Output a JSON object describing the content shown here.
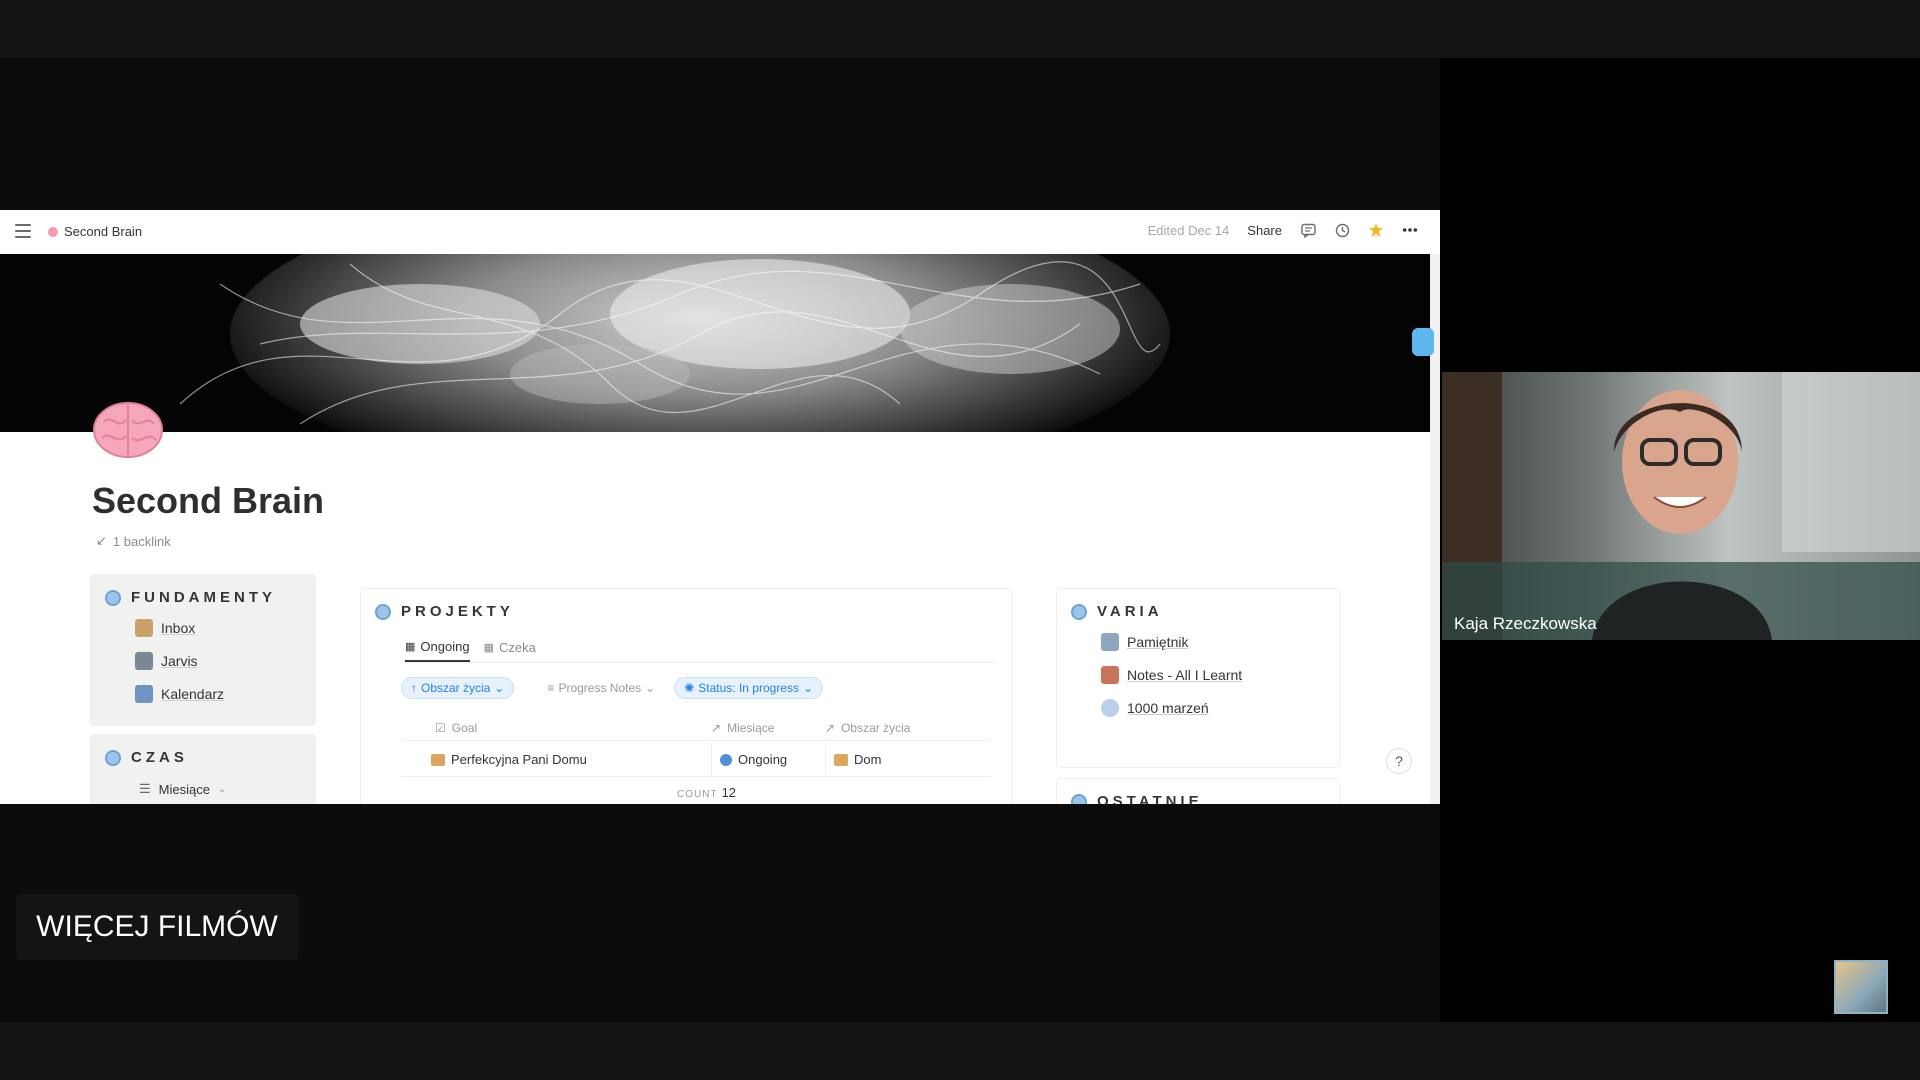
{
  "app": {
    "breadcrumb": "Second Brain",
    "edited": "Edited Dec 14",
    "share_label": "Share",
    "accent_color": "#2383e2"
  },
  "page": {
    "title": "Second Brain",
    "backlink": "1 backlink"
  },
  "fundamenty": {
    "title": "FUNDAMENTY",
    "items": [
      "Inbox",
      "Jarvis",
      "Kalendarz"
    ]
  },
  "czas": {
    "title": "CZAS",
    "view_label": "Miesiące"
  },
  "projekty": {
    "title": "PROJEKTY",
    "tabs": [
      "Ongoing",
      "Czeka"
    ],
    "filters": [
      "Obszar życia",
      "Progress Notes",
      "Status: In progress"
    ],
    "columns": [
      "Goal",
      "Miesiące",
      "Obszar życia"
    ],
    "rows": [
      {
        "goal": "Perfekcyjna Pani Domu",
        "status": "Ongoing",
        "area": "Dom"
      }
    ],
    "count_label": "COUNT",
    "count_value": "12"
  },
  "varia": {
    "title": "VARIA",
    "items": [
      "Pamiętnik",
      "Notes - All I Learnt",
      "1000 marzeń"
    ]
  },
  "ostatnie": {
    "title": "OSTATNIE"
  },
  "help_label": "?",
  "video": {
    "speaker_name": "Kaja Rzeczkowska"
  },
  "overlay": {
    "more_films": "WIĘCEJ FILMÓW"
  }
}
